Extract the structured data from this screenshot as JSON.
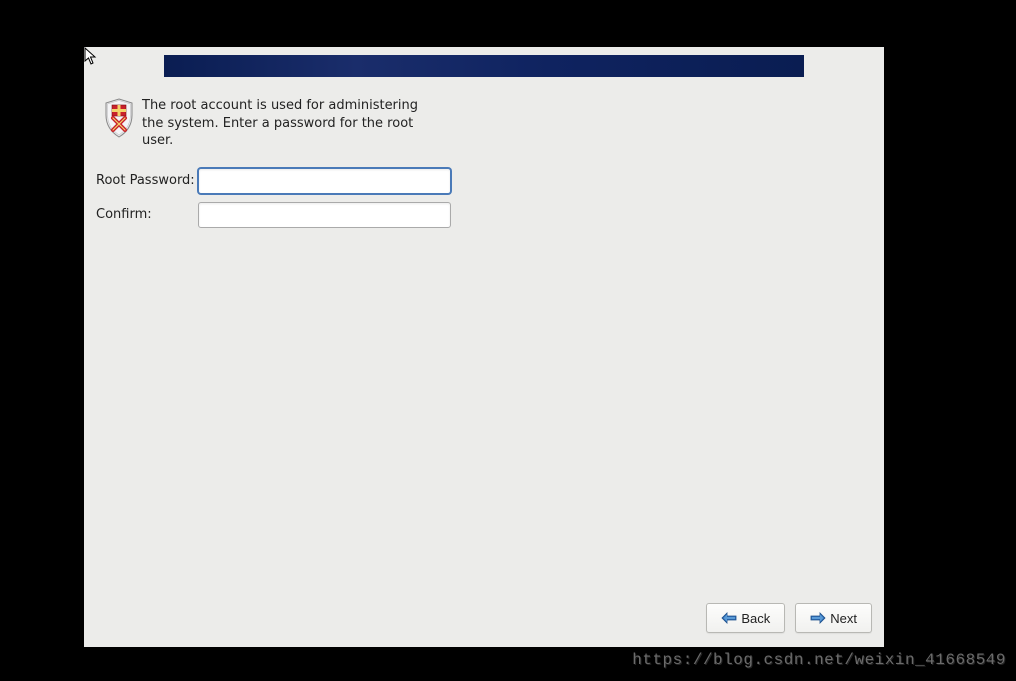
{
  "description": "The root account is used for administering the system.  Enter a password for the root user.",
  "form": {
    "root_password_label": "Root Password:",
    "root_password_value": "",
    "confirm_label": "Confirm:",
    "confirm_value": ""
  },
  "buttons": {
    "back_label": "Back",
    "next_label": "Next"
  },
  "watermark": "https://blog.csdn.net/weixin_41668549"
}
